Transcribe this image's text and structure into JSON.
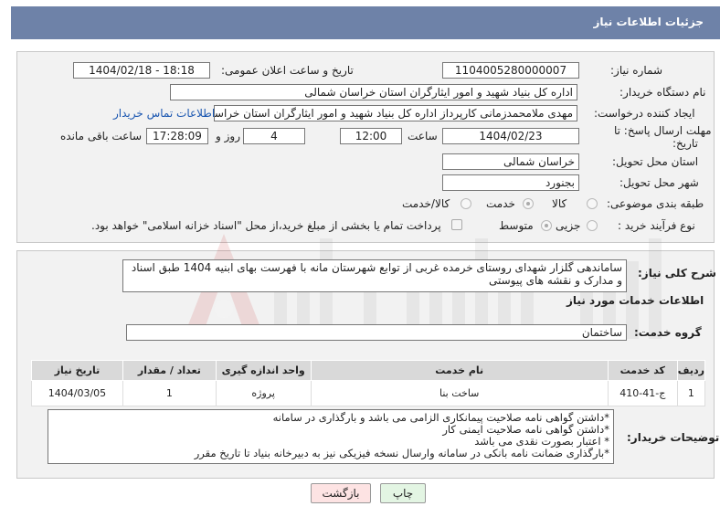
{
  "header": {
    "title": "جزئیات اطلاعات نیاز"
  },
  "form": {
    "need_number_label": "شماره نیاز:",
    "need_number": "1104005280000007",
    "announce_label": "تاریخ و ساعت اعلان عمومی:",
    "announce_value": "1404/02/18 - 18:18",
    "buyer_org_label": "نام دستگاه خریدار:",
    "buyer_org": "اداره کل بنیاد شهید و امور ایثارگران استان خراسان شمالی",
    "creator_label": "ایجاد کننده درخواست:",
    "creator": "مهدی  ملامحمدزمانی کارپرداز اداره کل بنیاد شهید و امور ایثارگران استان خراسان شمالی",
    "contact_link": "اطلاعات تماس خریدار",
    "deadline_label_1": "مهلت ارسال پاسخ: تا",
    "deadline_label_2": "تاریخ:",
    "deadline_date": "1404/02/23",
    "time_label": "ساعت",
    "deadline_time": "12:00",
    "days_value": "4",
    "days_label": "روز و",
    "remaining_time": "17:28:09",
    "remaining_label": "ساعت باقی مانده",
    "province_label": "استان محل تحویل:",
    "province": "خراسان شمالی",
    "city_label": "شهر محل تحویل:",
    "city": "بجنورد",
    "category_label": "طبقه بندی موضوعی:",
    "category_options": [
      "کالا",
      "خدمت",
      "کالا/خدمت"
    ],
    "category_selected": "خدمت",
    "purchase_type_label": "نوع فرآیند خرید :",
    "purchase_options": [
      "جزیی",
      "متوسط"
    ],
    "purchase_selected": "متوسط",
    "payment_note": "پرداخت تمام یا بخشی از مبلغ خرید،از محل \"اسناد خزانه اسلامی\" خواهد بود."
  },
  "details": {
    "description_label": "شرح کلی نیاز:",
    "description": "ساماندهی گلزار شهدای روستای خرمده غربی از توابع شهرستان مانه با فهرست بهای ابنیه 1404 طبق اسناد و مدارک و نقشه های پیوستی",
    "services_title": "اطلاعات خدمات مورد نیاز",
    "service_group_label": "گروه خدمت:",
    "service_group": "ساختمان",
    "table": {
      "headers": [
        "ردیف",
        "کد خدمت",
        "نام خدمت",
        "واحد اندازه گیری",
        "تعداد / مقدار",
        "تاریخ نیاز"
      ],
      "rows": [
        [
          "1",
          "ج-41-410",
          "ساخت بنا",
          "پروژه",
          "1",
          "1404/03/05"
        ]
      ]
    },
    "buyer_notes_label": "توضیحات خریدار:",
    "buyer_notes": [
      "*داشتن گواهی نامه صلاحیت پیمانکاری الزامی می باشد و بارگذاری در سامانه",
      "*داشتن گواهی نامه صلاحیت ایمنی کار",
      "* اعتبار بصورت نقدی می باشد",
      "*بارگذاری ضمانت نامه بانکی در سامانه وارسال نسخه فیزیکی نیز به دبیرخانه بنیاد تا تاریخ مقرر"
    ]
  },
  "buttons": {
    "print": "چاپ",
    "back": "بازگشت"
  },
  "watermark_text": "AriaTender.net",
  "colors": {
    "header_bg": "#6e82a8",
    "panel_bg": "#f2f2f2",
    "link": "#1a56b0",
    "back_btn_bg": "#fde3e3",
    "print_btn_bg": "#e3f5e3"
  }
}
